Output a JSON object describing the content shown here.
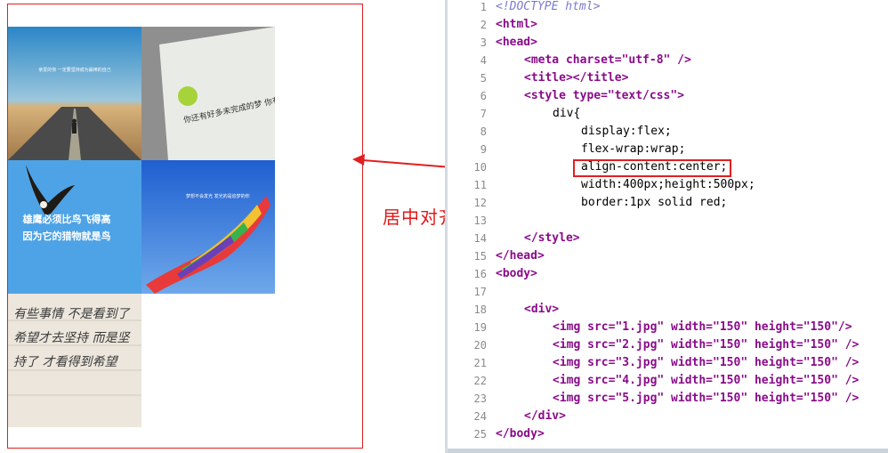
{
  "preview": {
    "tiles": [
      {
        "id": 1,
        "caption": "亲爱的你 一定要坚持成为最棒的自己"
      },
      {
        "id": 2,
        "caption": "你还有好多未完成的梦 你有什么理由停下脚步"
      },
      {
        "id": 3,
        "caption_line1": "雄鹰必须比鸟飞得高",
        "caption_line2": "因为它的猎物就是鸟"
      },
      {
        "id": 4,
        "caption": "梦想不会发光 发光的是追梦的你"
      },
      {
        "id": 5,
        "caption": "有些事情 不是看到了希望才去坚持 而是坚持了 才看得到希望"
      }
    ]
  },
  "annotation": {
    "text": "居中对齐，两端留白"
  },
  "editor": {
    "lines": [
      {
        "n": "1",
        "t": "<!DOCTYPE html>"
      },
      {
        "n": "2",
        "t": "<html>"
      },
      {
        "n": "3",
        "t": "<head>"
      },
      {
        "n": "4",
        "t": "<meta charset=\"utf-8\" />"
      },
      {
        "n": "5",
        "t": "<title></title>"
      },
      {
        "n": "6",
        "t": "<style type=\"text/css\">"
      },
      {
        "n": "7",
        "t": "div{"
      },
      {
        "n": "8",
        "t": "display:flex;"
      },
      {
        "n": "9",
        "t": "flex-wrap:wrap;"
      },
      {
        "n": "10",
        "t": "align-content:center;"
      },
      {
        "n": "11",
        "t": "width:400px;height:500px;"
      },
      {
        "n": "12",
        "t": "border:1px solid red;"
      },
      {
        "n": "13",
        "t": ""
      },
      {
        "n": "14",
        "t": "</style>"
      },
      {
        "n": "15",
        "t": "</head>"
      },
      {
        "n": "16",
        "t": "<body>"
      },
      {
        "n": "17",
        "t": ""
      },
      {
        "n": "18",
        "t": "<div>"
      },
      {
        "n": "19",
        "t": "<img src=\"1.jpg\" width=\"150\" height=\"150\"/>"
      },
      {
        "n": "20",
        "t": "<img src=\"2.jpg\" width=\"150\" height=\"150\" />"
      },
      {
        "n": "21",
        "t": "<img src=\"3.jpg\" width=\"150\" height=\"150\" />"
      },
      {
        "n": "22",
        "t": "<img src=\"4.jpg\" width=\"150\" height=\"150\" />"
      },
      {
        "n": "23",
        "t": "<img src=\"5.jpg\" width=\"150\" height=\"150\" />"
      },
      {
        "n": "24",
        "t": "</div>"
      },
      {
        "n": "25",
        "t": "</body>"
      }
    ]
  },
  "colors": {
    "border_red": "#e02020",
    "tag_purple": "#8a0b8a",
    "value_blue": "#0000c8"
  }
}
